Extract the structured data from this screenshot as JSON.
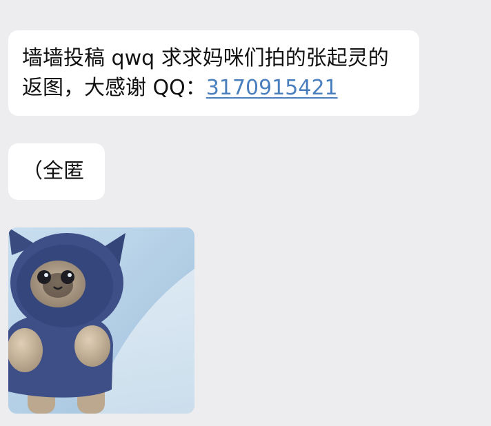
{
  "messages": [
    {
      "text_before": "墙墙投稿 qwq 求求妈咪们拍的张起灵的返图，大感谢 QQ：",
      "link": "3170915421"
    },
    {
      "text": "（全匿"
    }
  ],
  "sticker": {
    "icon": "hooded-cat-plush-sticker",
    "colors": {
      "background": "#bcd6ea",
      "hood": "#3d4f86",
      "face": "#b0a08c",
      "body": "#c8b59c"
    }
  }
}
